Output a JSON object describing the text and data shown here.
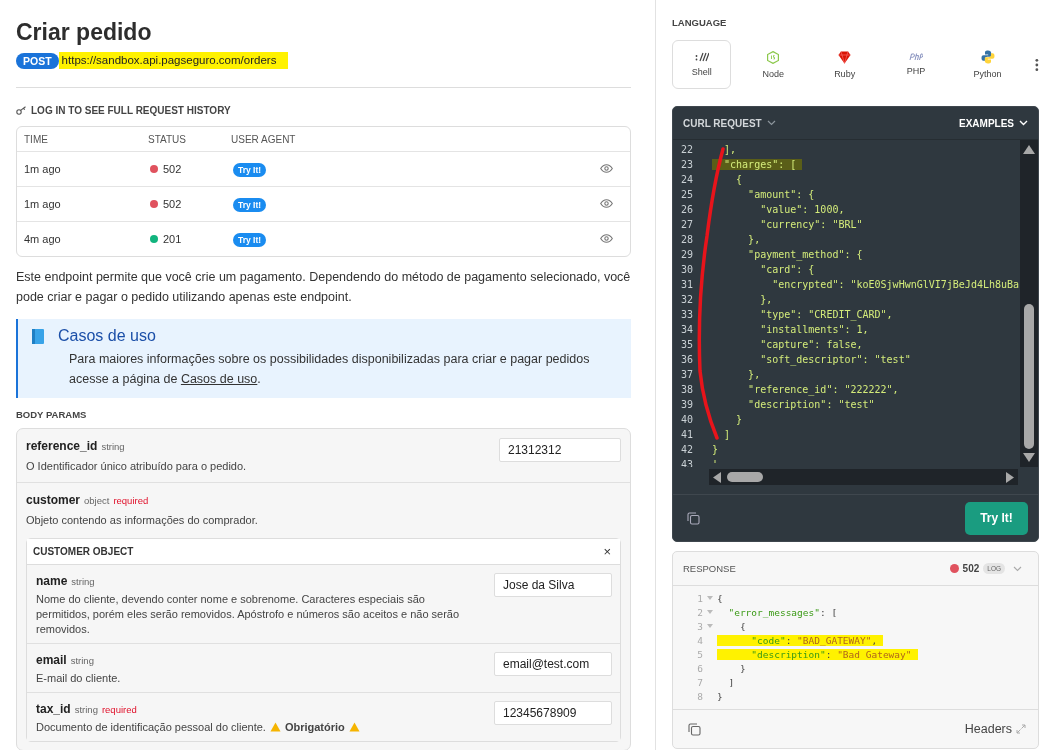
{
  "title": "Criar pedido",
  "endpoint": {
    "method": "POST",
    "url": "https://sandbox.api.pagseguro.com/orders",
    "marked": true
  },
  "history": {
    "heading": "LOG IN TO SEE FULL REQUEST HISTORY",
    "columns": [
      "TIME",
      "STATUS",
      "USER AGENT"
    ],
    "rows": [
      {
        "time": "1m ago",
        "status": "502",
        "color": "#e0525e",
        "agent": "Try It!"
      },
      {
        "time": "1m ago",
        "status": "502",
        "color": "#e0525e",
        "agent": "Try It!"
      },
      {
        "time": "4m ago",
        "status": "201",
        "color": "#12b47e",
        "agent": "Try It!"
      }
    ]
  },
  "description": "Este endpoint permite que você crie um pagamento. Dependendo do método de pagamento selecionado, você pode criar e pagar o pedido utilizando apenas este endpoint.",
  "callout": {
    "title": "Casos de uso",
    "text_before": "Para maiores informações sobre os possibilidades disponibilizadas para criar e pagar pedidos acesse a página de ",
    "link": "Casos de uso",
    "text_after": "."
  },
  "body_params": {
    "heading": "BODY PARAMS",
    "params": [
      {
        "name": "reference_id",
        "type": "string",
        "description": "O Identificador único atribuído para o pedido.",
        "value": "21312312"
      },
      {
        "name": "customer",
        "type": "object",
        "required": "required",
        "description": "Objeto contendo as informações do comprador.",
        "object": {
          "title": "CUSTOMER OBJECT",
          "close": "×",
          "fields": [
            {
              "name": "name",
              "type": "string",
              "description": "Nome do cliente, devendo conter nome e sobrenome. Caracteres especiais são permitidos, porém eles serão removidos. Apóstrofo e números são aceitos e não serão removidos.",
              "value": "Jose da Silva"
            },
            {
              "name": "email",
              "type": "string",
              "description": "E-mail do cliente.",
              "value": "email@test.com"
            },
            {
              "name": "tax_id",
              "type": "string",
              "required": "required",
              "description": "Documento de identificação pessoal do cliente.",
              "warning": "Obrigatório",
              "value": "12345678909"
            }
          ]
        }
      }
    ]
  },
  "language": {
    "heading": "LANGUAGE",
    "options": [
      {
        "label": "Shell",
        "kind": "shell",
        "selected": true
      },
      {
        "label": "Node",
        "kind": "node",
        "selected": false
      },
      {
        "label": "Ruby",
        "kind": "ruby",
        "selected": false
      },
      {
        "label": "PHP",
        "kind": "php",
        "selected": false
      },
      {
        "label": "Python",
        "kind": "python",
        "selected": false
      }
    ]
  },
  "request": {
    "title": "CURL REQUEST",
    "examples": "EXAMPLES",
    "button": "Try It!",
    "lines": [
      {
        "n": "22",
        "text": "  ],"
      },
      {
        "n": "23",
        "text": "  \"charges\": [",
        "marked": true
      },
      {
        "n": "24",
        "text": "    {"
      },
      {
        "n": "25",
        "text": "      \"amount\": {"
      },
      {
        "n": "26",
        "text": "        \"value\": 1000,"
      },
      {
        "n": "27",
        "text": "        \"currency\": \"BRL\""
      },
      {
        "n": "28",
        "text": "      },"
      },
      {
        "n": "29",
        "text": "      \"payment_method\": {"
      },
      {
        "n": "30",
        "text": "        \"card\": {"
      },
      {
        "n": "31",
        "text": "          \"encrypted\": \"koE0SjwHwnGlVI7jBeJd4Lh8uBa"
      },
      {
        "n": "32",
        "text": "        },"
      },
      {
        "n": "33",
        "text": "        \"type\": \"CREDIT_CARD\","
      },
      {
        "n": "34",
        "text": "        \"installments\": 1,"
      },
      {
        "n": "35",
        "text": "        \"capture\": false,"
      },
      {
        "n": "36",
        "text": "        \"soft_descriptor\": \"test\""
      },
      {
        "n": "37",
        "text": "      },"
      },
      {
        "n": "38",
        "text": "      \"reference_id\": \"222222\","
      },
      {
        "n": "39",
        "text": "      \"description\": \"test\""
      },
      {
        "n": "40",
        "text": "    }"
      },
      {
        "n": "41",
        "text": "  ]"
      },
      {
        "n": "42",
        "text": "}"
      },
      {
        "n": "43",
        "text": "'"
      }
    ]
  },
  "response": {
    "title": "RESPONSE",
    "status": "502",
    "color": "#e0525e",
    "badge": "LOG",
    "headers": "Headers",
    "lines": [
      {
        "n": "1",
        "text": "{",
        "foldable": true
      },
      {
        "n": "2",
        "text": "  \"error_messages\": [",
        "foldable": true
      },
      {
        "n": "3",
        "text": "    {",
        "foldable": true
      },
      {
        "n": "4",
        "text": "      \"code\": \"BAD_GATEWAY\",",
        "marked": true
      },
      {
        "n": "5",
        "text": "      \"description\": \"Bad Gateway\"",
        "marked": true
      },
      {
        "n": "6",
        "text": "    }"
      },
      {
        "n": "7",
        "text": "  ]"
      },
      {
        "n": "8",
        "text": "}"
      }
    ]
  }
}
